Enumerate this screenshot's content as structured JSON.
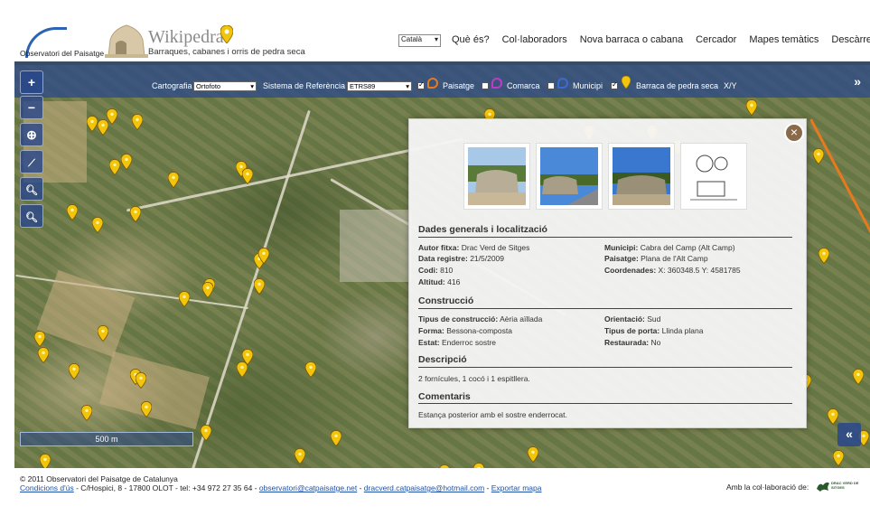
{
  "header": {
    "observatori_logo_text": "Observatori del Paisatge",
    "site_name": "Wikipedra",
    "site_tagline": "Barraques, cabanes i orris de pedra seca",
    "language": "Català",
    "nav": [
      "Què és?",
      "Col·laboradors",
      "Nova barraca o cabana",
      "Cercador",
      "Mapes temàtics",
      "Descàrrega"
    ]
  },
  "toolbar": {
    "cartography_label": "Cartografia",
    "cartography_value": "Ortofoto",
    "reference_label": "Sistema de Referència",
    "reference_value": "ETRS89",
    "layers": [
      {
        "label": "Paisatge",
        "checked": true,
        "color": "#e87a1e"
      },
      {
        "label": "Comarca",
        "checked": false,
        "color": "#c03ac8"
      },
      {
        "label": "Municipi",
        "checked": false,
        "color": "#3a6ad8"
      },
      {
        "label": "Barraca de pedra seca",
        "checked": true,
        "color": "#f2c40c"
      }
    ],
    "coord_label": "X/Y",
    "expand_icon": "»"
  },
  "map_controls": {
    "zoom_in": "+",
    "zoom_out": "−",
    "scale_label": "500 m",
    "collapse_icon": "«"
  },
  "popup": {
    "close_icon": "×",
    "general": {
      "title": "Dades generals i localització",
      "author_label": "Autor fitxa:",
      "author": "Drac Verd de Sitges",
      "date_label": "Data registre:",
      "date": "21/5/2009",
      "code_label": "Codi:",
      "code": "810",
      "altitude_label": "Altitud:",
      "altitude": "416",
      "municipality_label": "Municipi:",
      "municipality": "Cabra del Camp (Alt Camp)",
      "landscape_label": "Paisatge:",
      "landscape": "Plana de l'Alt Camp",
      "coords_label": "Coordenades:",
      "coords": "X: 360348.5 Y: 4581785"
    },
    "construction": {
      "title": "Construcció",
      "type_label": "Tipus de construcció:",
      "type": "Aèria aïllada",
      "form_label": "Forma:",
      "form": "Bessona-composta",
      "state_label": "Estat:",
      "state": "Enderroc sostre",
      "orientation_label": "Orientació:",
      "orientation": "Sud",
      "door_label": "Tipus de porta:",
      "door": "Llinda plana",
      "restored_label": "Restaurada:",
      "restored": "No"
    },
    "description": {
      "title": "Descripció",
      "text": "2 fornícules, 1 cocó i 1 espitllera."
    },
    "comments": {
      "title": "Comentaris",
      "text": "Estança posterior amb el sostre enderrocat."
    }
  },
  "footer": {
    "copyright": "© 2011 Observatori del Paisatge de Catalunya",
    "terms_link": "Condicions d'ús",
    "address": " - C/Hospici, 8 - 17800 OLOT - tel: +34 972 27 35 64 - ",
    "email1": "observatori@catpaisatge.net",
    "sep1": " - ",
    "email2": "dracverd.catpaisatge@hotmail.com",
    "sep2": " - ",
    "export_link": "Exportar mapa",
    "collab_text": "Amb la col·laboració de:",
    "collab_logo_text": "DRAC VERD DE SITGES"
  }
}
